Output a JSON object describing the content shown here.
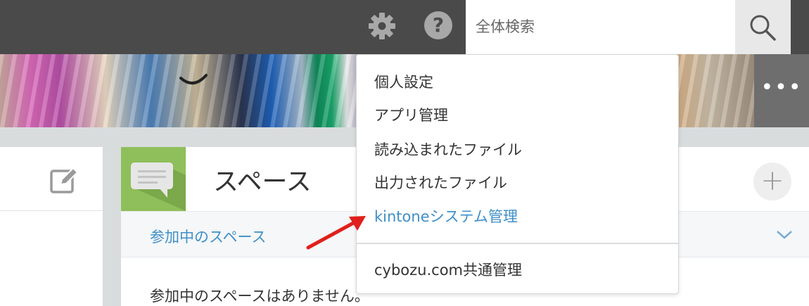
{
  "header": {
    "search_placeholder": "全体検索",
    "help_glyph": "?"
  },
  "banner": {
    "more_label": "•••"
  },
  "space": {
    "title": "スペース",
    "plus_label": "+",
    "participating_label": "参加中のスペース",
    "empty_message": "参加中のスペースはありません。"
  },
  "menu": {
    "items": [
      {
        "label": "個人設定"
      },
      {
        "label": "アプリ管理"
      },
      {
        "label": "読み込まれたファイル"
      },
      {
        "label": "出力されたファイル"
      },
      {
        "label": "kintoneシステム管理"
      }
    ],
    "footer_item": {
      "label": "cybozu.com共通管理"
    }
  },
  "colors": {
    "header_bg": "#4a4a4a",
    "link_blue": "#3f8fc8",
    "space_tile_green": "#8fbf5a",
    "arrow_red": "#e0201c"
  },
  "icons": [
    "gear-icon",
    "help-icon",
    "search-icon",
    "more-icon",
    "edit-icon",
    "space-chat-icon",
    "plus-icon",
    "chevron-down-icon"
  ]
}
